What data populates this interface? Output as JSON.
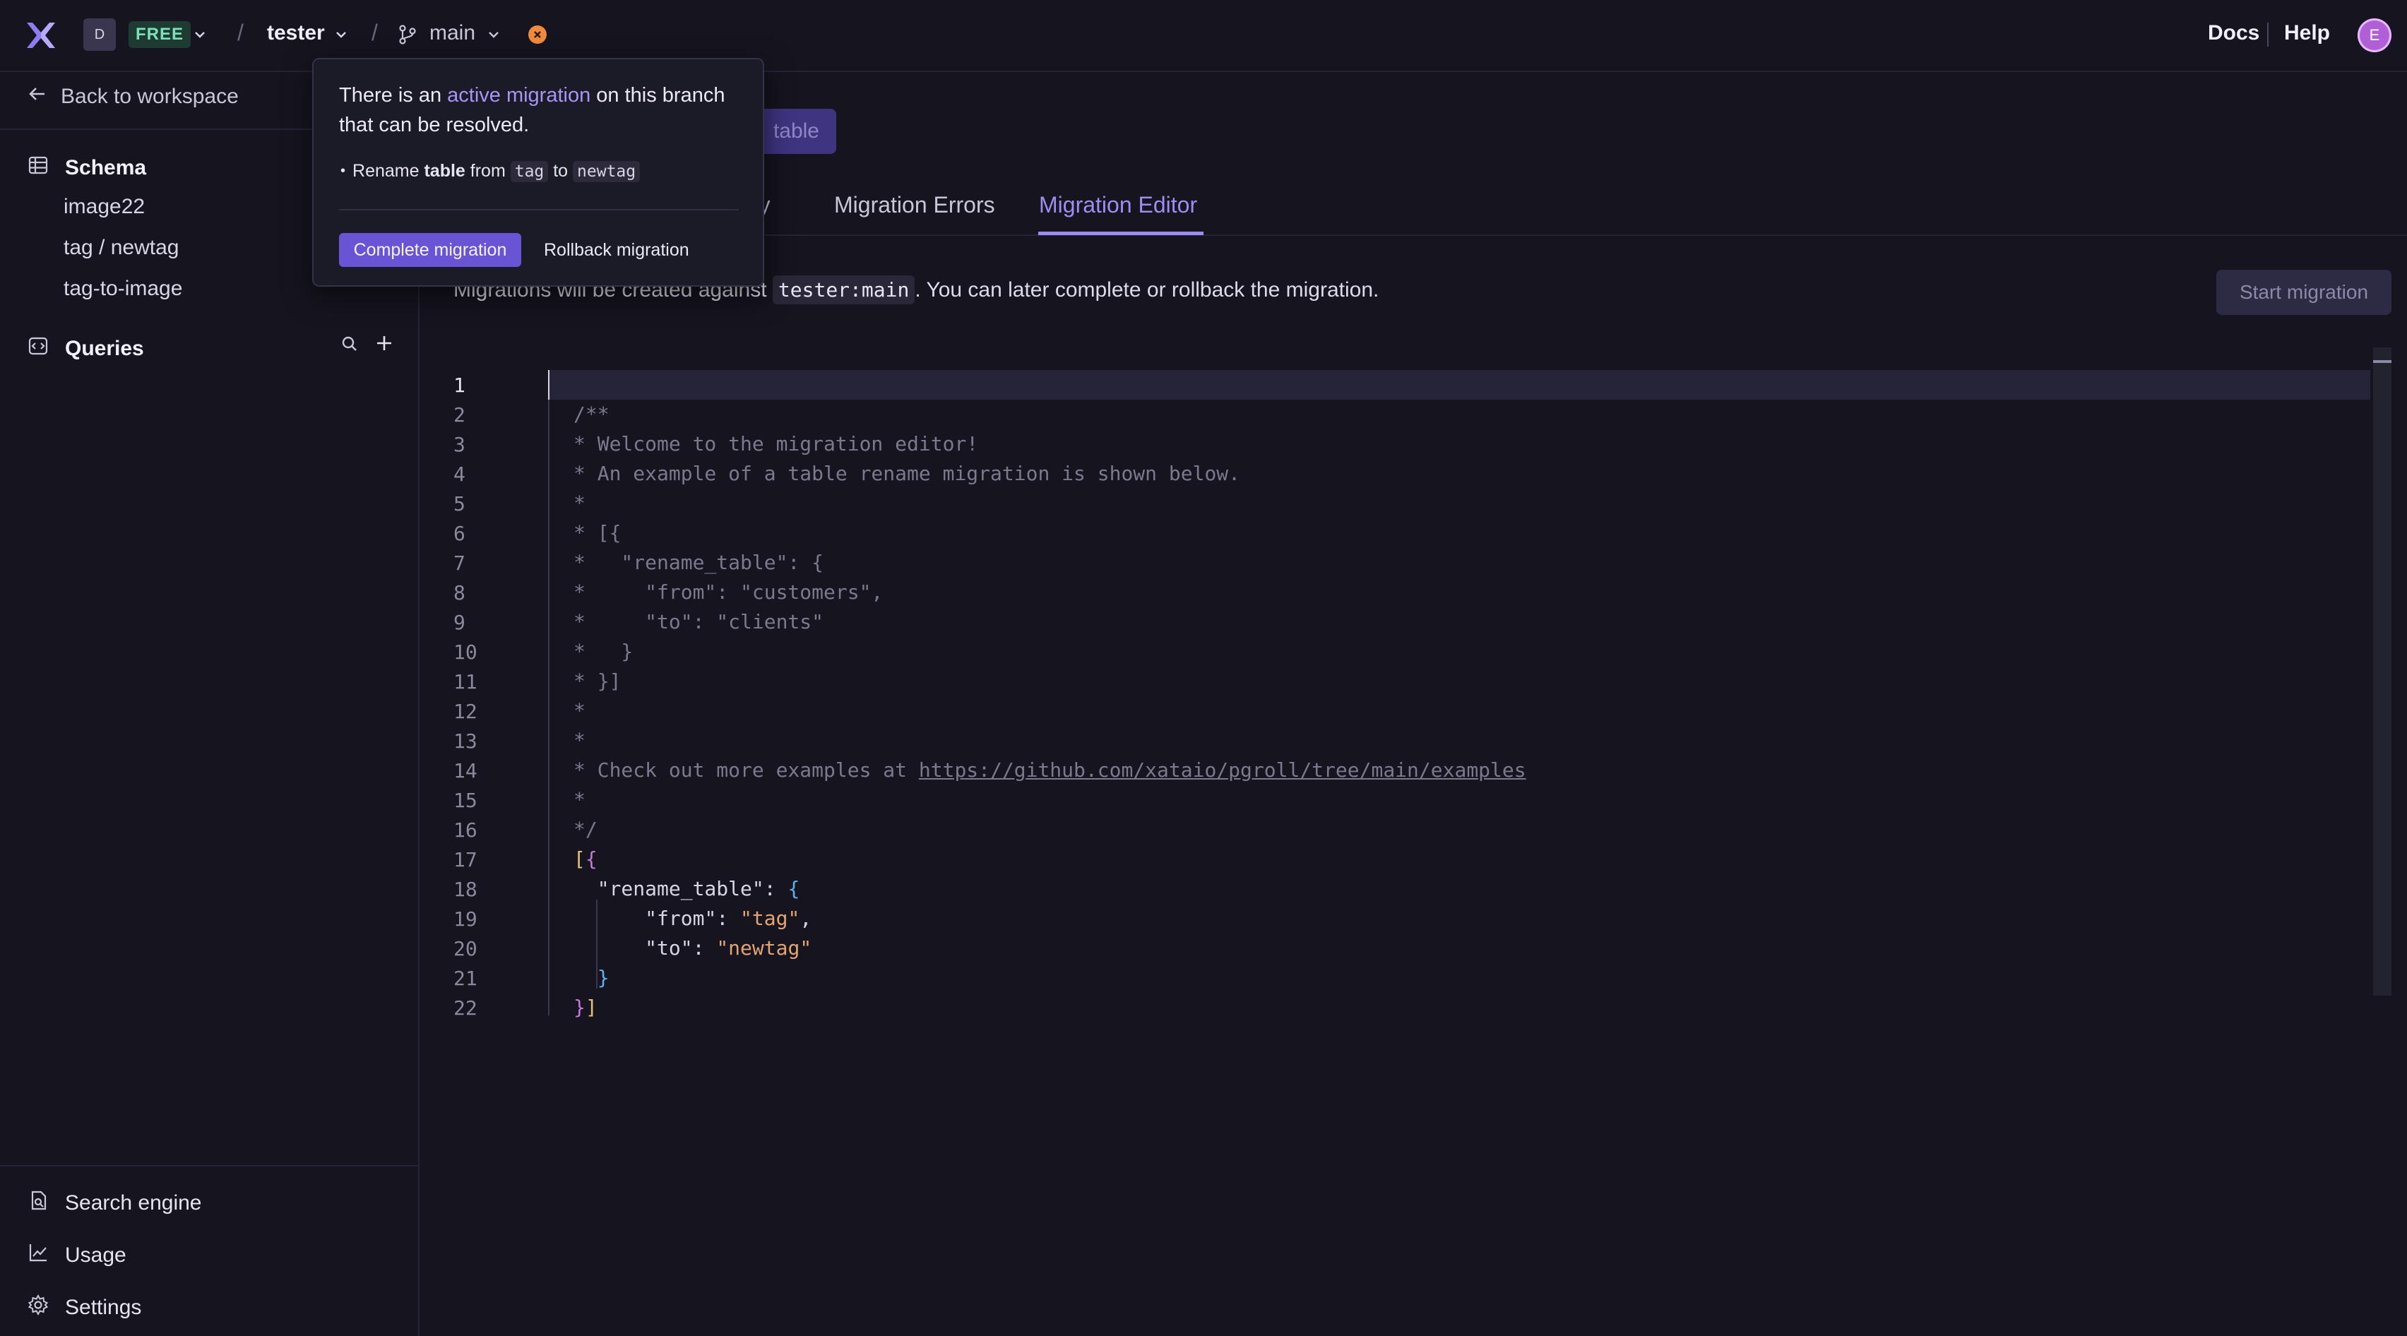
{
  "topbar": {
    "workspace_initial": "D",
    "plan_badge": "FREE",
    "database": "tester",
    "branch": "main",
    "docs": "Docs",
    "help": "Help",
    "user_initial": "E"
  },
  "sidebar": {
    "back": "Back to workspace",
    "schema_title": "Schema",
    "tables": [
      "image22",
      "tag / newtag",
      "tag-to-image"
    ],
    "queries_title": "Queries",
    "bottom": {
      "search": "Search engine",
      "usage": "Usage",
      "settings": "Settings"
    }
  },
  "main": {
    "create_button": "table",
    "tabs": {
      "history": "ory",
      "errors": "Migration Errors",
      "editor": "Migration Editor"
    },
    "info_before": "Migrations will be created against ",
    "info_ref": "tester:main",
    "info_after": ". You can later complete or rollback the migration.",
    "start_button": "Start migration"
  },
  "popup": {
    "text_before": "There is an ",
    "link": "active migration",
    "text_after": " on this branch that can be resolved.",
    "item_prefix": "Rename ",
    "item_bold": "table",
    "item_from": " from ",
    "item_old": "tag",
    "item_to": " to ",
    "item_new": "newtag",
    "complete": "Complete migration",
    "rollback": "Rollback migration"
  },
  "editor": {
    "line_numbers": [
      "1",
      "2",
      "3",
      "4",
      "5",
      "6",
      "7",
      "8",
      "9",
      "10",
      "11",
      "12",
      "13",
      "14",
      "15",
      "16",
      "17",
      "18",
      "19",
      "20",
      "21",
      "22"
    ],
    "comment_lines": [
      "/**",
      "* Welcome to the migration editor!",
      "* An example of a table rename migration is shown below.",
      "*",
      "* [{",
      "*   \"rename_table\": {",
      "*     \"from\": \"customers\",",
      "*     \"to\": \"clients\"",
      "*   }",
      "* }]",
      "*",
      "*"
    ],
    "examples_prefix": "* Check out more examples at ",
    "examples_url": "https://github.com/xataio/pgroll/tree/main/examples",
    "comment_end_1": "*",
    "comment_end_2": "*/",
    "code": {
      "open": "[{",
      "key_rename": "\"rename_table\"",
      "key_from": "\"from\"",
      "val_from": "\"tag\"",
      "key_to": "\"to\"",
      "val_to": "\"newtag\""
    }
  },
  "colors": {
    "accent": "#9f8cf3",
    "primary_button": "#6a54d6",
    "status_dot": "#f08a3c",
    "background": "#15141f"
  }
}
